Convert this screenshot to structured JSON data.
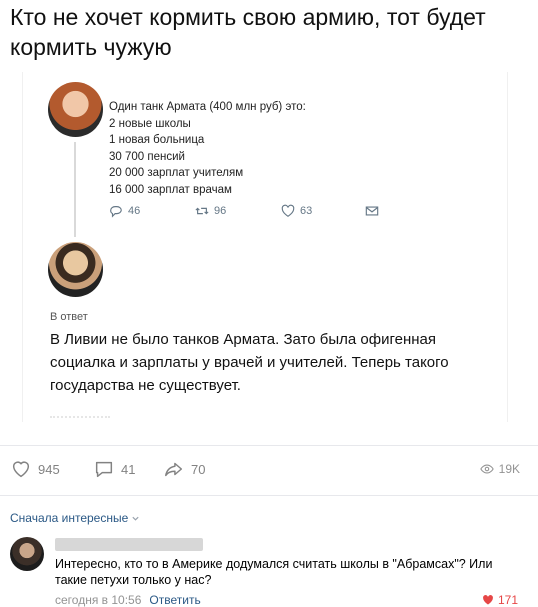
{
  "post": {
    "title": "Кто не хочет кормить свою армию, тот будет кормить чужую"
  },
  "tweet": {
    "lines": [
      "Один танк Армата (400 млн руб) это:",
      "2 новые школы",
      "1 новая больница",
      "30 700 пенсий",
      "20 000 зарплат учителям",
      "16 000 зарплат врачам"
    ],
    "actions": {
      "replies": "46",
      "retweets": "96",
      "likes": "63"
    }
  },
  "reply": {
    "label": "В ответ",
    "text": "В Ливии не было танков Армата. Зато была офигенная социалка и зарплаты у врачей и учителей. Теперь такого государства не существует."
  },
  "post_actions": {
    "likes": "945",
    "comments": "41",
    "shares": "70",
    "views": "19K"
  },
  "comments": {
    "sort_label": "Сначала интересные",
    "items": [
      {
        "text": "Интересно, кто то в Америке додумался считать школы в \"Абрамсах\"? Или такие петухи только у нас?",
        "time": "сегодня в 10:56",
        "reply_label": "Ответить",
        "likes": "171"
      }
    ]
  },
  "colors": {
    "link": "#2a5885",
    "like_red": "#e64646",
    "muted": "#828282"
  },
  "icons": [
    "reply-icon",
    "retweet-icon",
    "heart-icon",
    "mail-icon",
    "comment-icon",
    "share-icon",
    "eye-icon",
    "chevron-down-icon"
  ]
}
